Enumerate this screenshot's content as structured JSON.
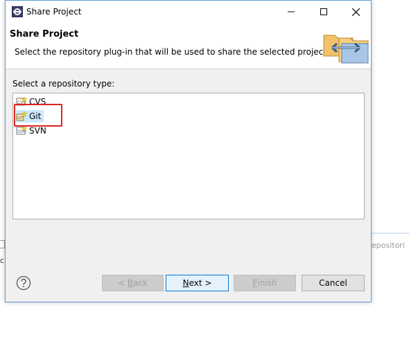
{
  "window": {
    "title": "Share Project",
    "controls": [
      "minimize",
      "maximize",
      "close"
    ]
  },
  "header": {
    "title": "Share Project",
    "description": "Select the repository plug-in that will be used to share the selected project."
  },
  "content": {
    "label": "Select a repository type:",
    "repository_types": [
      {
        "label": "CVS",
        "icon": "cvs-icon",
        "selected": false
      },
      {
        "label": "Git",
        "icon": "git-icon",
        "selected": true
      },
      {
        "label": "SVN",
        "icon": "svn-icon",
        "selected": false
      }
    ]
  },
  "buttons": {
    "back": {
      "prefix": "< ",
      "mnemonic": "B",
      "rest": "ack",
      "enabled": false
    },
    "next": {
      "mnemonic": "N",
      "rest": "ext >",
      "enabled": true
    },
    "finish": {
      "mnemonic": "F",
      "rest": "inish",
      "enabled": false
    },
    "cancel": {
      "label": "Cancel",
      "enabled": true
    }
  },
  "background": {
    "right_text": "epositori",
    "left_text": "c"
  },
  "colors": {
    "accent": "#5a9bd5",
    "selection": "#cce8ff",
    "highlight": "#e02020"
  }
}
